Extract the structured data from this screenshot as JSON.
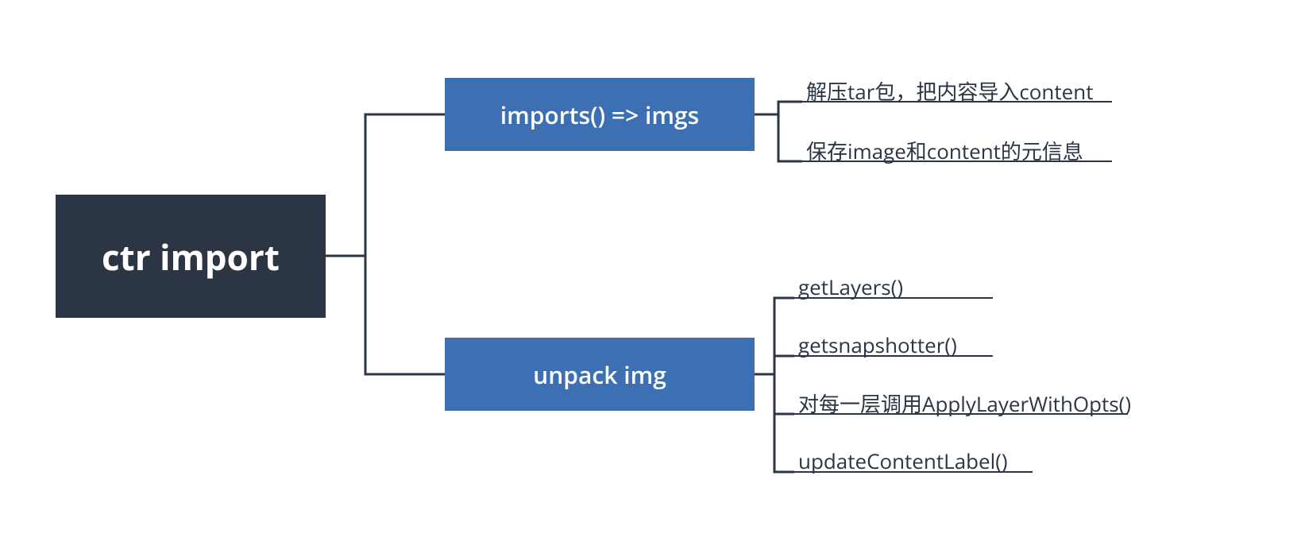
{
  "root": {
    "label": "ctr import"
  },
  "mid": {
    "imports": {
      "label": "imports()  => imgs"
    },
    "unpack": {
      "label": "unpack img"
    }
  },
  "leaves": {
    "imports": [
      "解压tar包，把内容导入content",
      "保存image和content的元信息"
    ],
    "unpack": [
      "getLayers()",
      "getsnapshotter()",
      "对每一层调用ApplyLayerWithOpts()",
      "updateContentLabel()"
    ]
  }
}
